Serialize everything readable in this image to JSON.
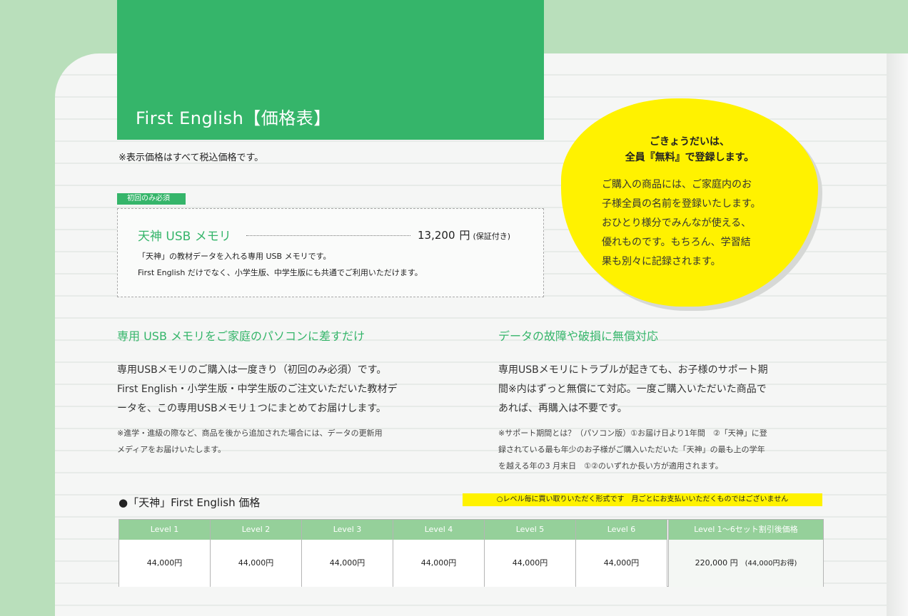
{
  "header": {
    "title": "First English【価格表】"
  },
  "tax_note": "※表示価格はすべて税込価格です。",
  "required_tag": "初回のみ必須",
  "product": {
    "name": "天神 USB メモリ",
    "price": "13,200",
    "yen": "円",
    "price_note": "(保証付き)",
    "desc_lines": [
      "「天神」の教材データを入れる専用 USB メモリです。",
      "First English だけでなく、小学生版、中学生版にも共通でご利用いただけます。"
    ]
  },
  "bubble": {
    "headline": [
      "ごきょうだいは、",
      "全員『無料』で登録します。"
    ],
    "body": [
      "ご購入の商品には、ご家庭内のお",
      "子様全員の名前を登録いたします。",
      "おひとり様分でみんなが使える、",
      "優れものです。もちろん、学習結",
      "果も別々に記録されます。"
    ],
    "color": "#fff200"
  },
  "section_left": {
    "title": "専用 USB メモリをご家庭のパソコンに差すだけ",
    "paragraph": [
      "専用USBメモリのご購入は一度きり（初回のみ必須）です。",
      "First English・小学生版・中学生版のご注文いただいた教材デ",
      "ータを、この専用USBメモリ１つにまとめてお届けします。"
    ],
    "note": [
      "※進学・進級の際など、商品を後から追加された場合には、データの更新用",
      "メディアをお届けいたします。"
    ]
  },
  "section_right": {
    "title": "データの故障や破損に無償対応",
    "paragraph": [
      "専用USBメモリにトラブルが起きても、お子様のサポート期",
      "間※内はずっと無償にて対応。一度ご購入いただいた商品で",
      "あれば、再購入は不要です。"
    ],
    "note": [
      "※サポート期間とは？（パソコン版）①お届け日より1年間　②「天神」に登",
      "録されている最も年少のお子様がご購入いただいた「天神」の最も上の学年",
      "を越える年の3 月末日　①②のいずれか長い方が適用されます。"
    ]
  },
  "table": {
    "title": "●「天神」First English 価格",
    "yellow_note": "○レベル毎に買い取りいただく形式です　月ごとにお支払いいただくものではございません",
    "headers": [
      "Level 1",
      "Level 2",
      "Level 3",
      "Level 4",
      "Level 5",
      "Level 6",
      "Level 1〜6セット割引後価格"
    ],
    "prices": [
      "44,000円",
      "44,000円",
      "44,000円",
      "44,000円",
      "44,000円",
      "44,000円"
    ],
    "total_price": "220,000 円",
    "total_note": "(44,000円お得)",
    "header_color": "#95d09a"
  },
  "colors": {
    "accent_green": "#35b56a",
    "page_background": "#b9dfbb",
    "highlight_yellow": "#fff200"
  }
}
